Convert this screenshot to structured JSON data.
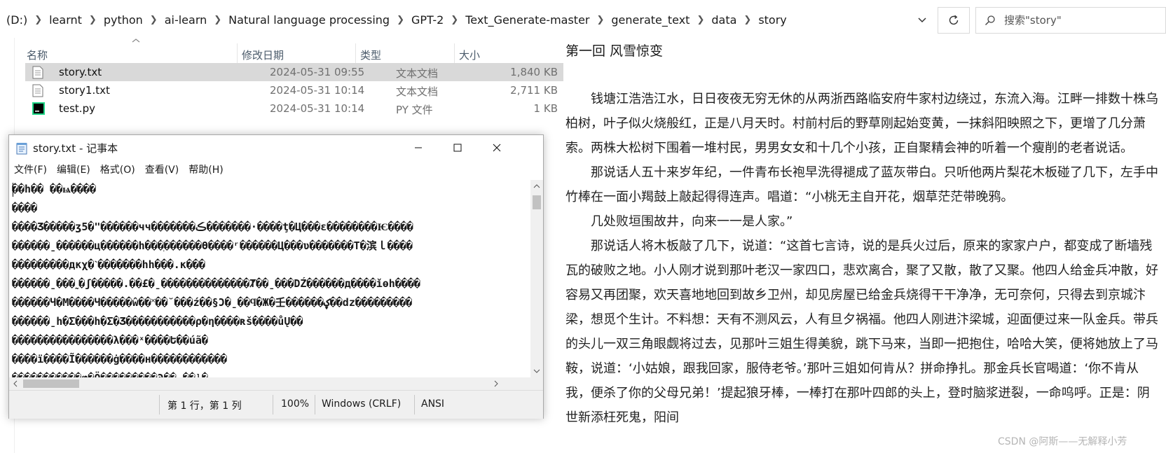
{
  "address_bar": {
    "breadcrumbs": [
      "(D:)",
      "learnt",
      "python",
      "ai-learn",
      "Natural language processing",
      "GPT-2",
      "Text_Generate-master",
      "generate_text",
      "data",
      "story"
    ],
    "search_placeholder": "搜索\"story\""
  },
  "file_list": {
    "columns": {
      "name": "名称",
      "date": "修改日期",
      "type": "类型",
      "size": "大小"
    },
    "files": [
      {
        "name": "story.txt",
        "date": "2024-05-31 09:55",
        "type": "文本文档",
        "size": "1,840 KB",
        "icon": "text-file-icon",
        "selected": true
      },
      {
        "name": "story1.txt",
        "date": "2024-05-31 10:14",
        "type": "文本文档",
        "size": "2,711 KB",
        "icon": "text-file-icon",
        "selected": false
      },
      {
        "name": "test.py",
        "date": "2024-05-31 10:14",
        "type": "PY 文件",
        "size": "1 KB",
        "icon": "pycharm-file-icon",
        "selected": false
      }
    ]
  },
  "notepad": {
    "title": "story.txt - 记事本",
    "menu": [
      "文件(F)",
      "编辑(E)",
      "格式(O)",
      "查看(V)",
      "帮助(H)"
    ],
    "lines": [
      "��h�� ��ѩ����",
      "����",
      "����Ʒ�����ʒ5�\"������чч�������ڪ�������·����ţ�Ц���ε��������Ѥ����",
      "������ˍ������ц������h���ׅ������Ө����ʳ������Ц���ʋ�������Τ�滨ｌ����",
      "���������дкχ�ˋ�������hh���.ĸ���",
      "������ˍ���˷�ʃ�����.��£�ˍ��������������Ⱦ��ˍ���DŹ������д����ǐɵh����",
      "������Ч�М����Ч�����ŵ��˟��˘���ź��§Ͻ�ˍ��ϥ�Ж�壬������ؼ��dz���������",
      "������ˍh�Σ���h�Σ�Ʒ�����������ρ�ƞ����ʀš����ůŲ��",
      "����������������λ���ˣ����Ե��úã�",
      "����ï����Ĩ������ġ����н������������",
      "�����������ⱷ�Ö���������Ͽ��.��ˡ�"
    ],
    "status": {
      "position": "第 1 行，第 1 列",
      "zoom": "100%",
      "line_ending": "Windows (CRLF)",
      "encoding": "ANSI"
    }
  },
  "preview": {
    "title": "第一回 风雪惊变",
    "paragraphs": [
      "钱塘江浩浩江水，日日夜夜无穷无休的从两浙西路临安府牛家村边绕过，东流入海。江畔一排数十株乌柏树，叶子似火烧般红，正是八月天时。村前村后的野草刚起始变黄，一抹斜阳映照之下，更增了几分萧索。两株大松树下围着一堆村民，男男女女和十几个小孩，正自聚精会神的听着一个瘦削的老者说话。",
      "那说话人五十来岁年纪，一件青布长袍早洗得褪成了蓝灰带白。只听他两片梨花木板碰了几下，左手中竹棒在一面小羯鼓上敲起得得连声。唱道：“小桃无主自开花，烟草茫茫带晚鸦。",
      "几处败垣围故井，向来一一是人家。”",
      "那说话人将木板敲了几下，说道：“这首七言诗，说的是兵火过后，原来的家家户户，都变成了断墙残瓦的破败之地。小人刚才说到那叶老汉一家四口，悲欢离合，聚了又散，散了又聚。他四人给金兵冲散，好容易又再团聚，欢天喜地地回到故乡卫州，却见房屋已给金兵烧得干干净净，无可奈何，只得去到京城汴梁，想觅个生计。不料想：天有不测风云，人有旦夕祸福。他四人刚进汴梁城，迎面便过来一队金兵。带兵的头儿一双三角眼觑将过去，见那叶三姐生得美貌，跳下马来，当即一把抱住，哈哈大笑，便将她放上了马鞍，说道：‘小姑娘，跟我回家，服侍老爷。’那叶三姐如何肯从？拼命挣扎。那金兵长官喝道：‘你不肯从我，便杀了你的父母兄弟！’提起狼牙棒，一棒打在那叶四郎的头上，登时脑浆迸裂，一命呜呼。正是：阴世新添枉死鬼，阳间"
    ],
    "watermark": "CSDN @阿斯——无解释小芳"
  }
}
